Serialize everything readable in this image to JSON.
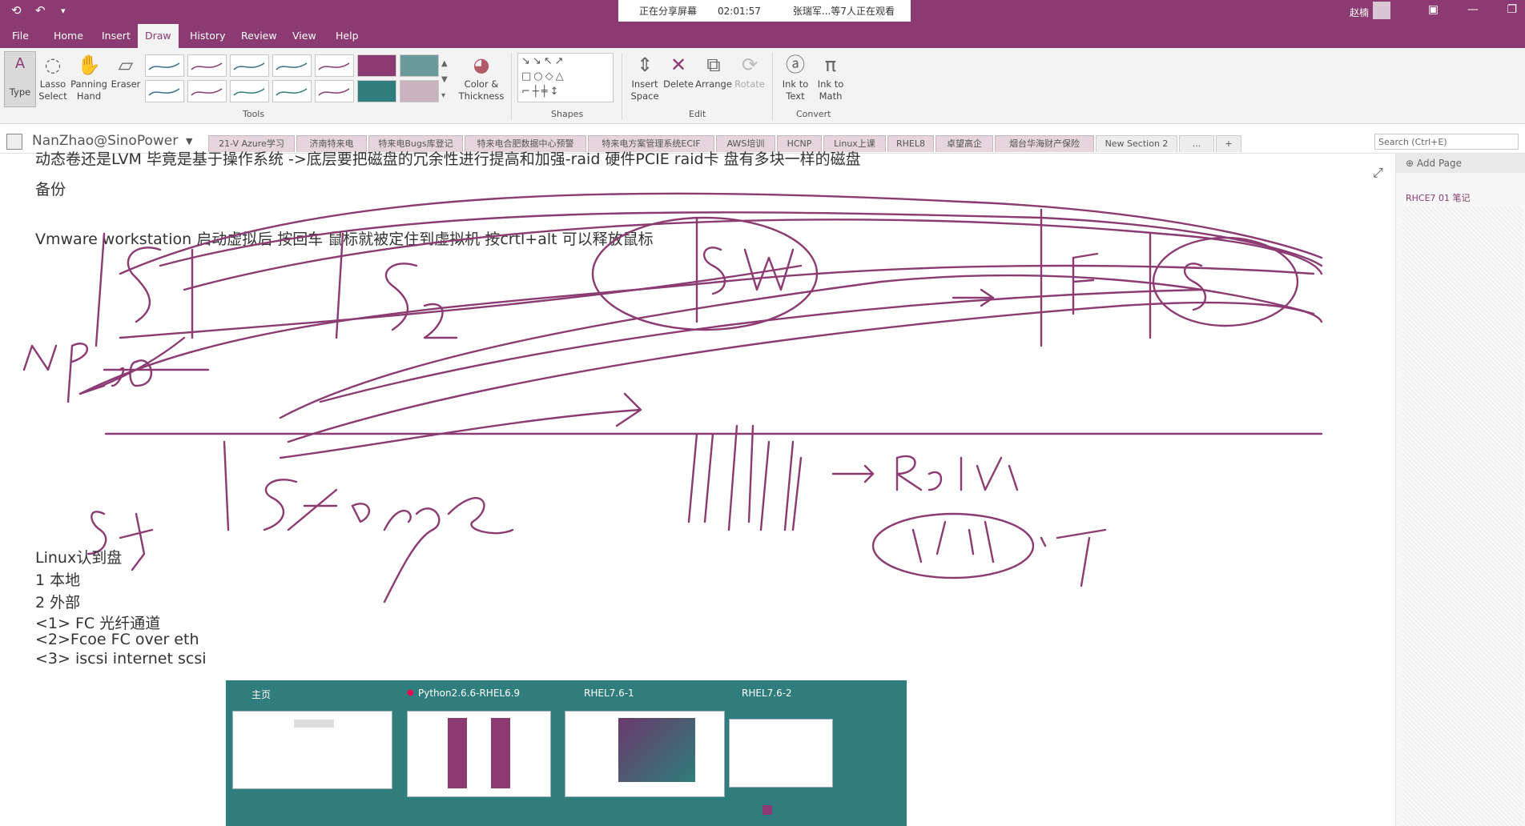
{
  "titlebar": {
    "share_status": "正在分享屏幕",
    "share_time": "02:01:57",
    "viewers": "张瑞军...等7人正在观看",
    "user": "赵楠"
  },
  "menu": [
    "File",
    "Home",
    "Insert",
    "Draw",
    "History",
    "Review",
    "View",
    "Help"
  ],
  "ribbon": {
    "type_label": "Type",
    "lasso_label": "Lasso Select",
    "panning_label": "Panning Hand",
    "eraser_label": "Eraser",
    "tools_group": "Tools",
    "color_label": "Color & Thickness",
    "shapes_group": "Shapes",
    "insert_space_label": "Insert Space",
    "delete_label": "Delete",
    "arrange_label": "Arrange",
    "rotate_label": "Rotate",
    "edit_group": "Edit",
    "ink_text_label": "Ink to Text",
    "ink_math_label": "Ink to Math",
    "convert_group": "Convert",
    "pen_colors": [
      "#3a6d8c",
      "#8b3a72",
      "#3a6d8c",
      "#3a6d8c",
      "#8b3a72",
      "#2f7d7c"
    ]
  },
  "notebook": {
    "name": "NanZhao@SinoPower",
    "tabs": [
      "21-V Azure学习",
      "济南特来电",
      "特来电Bugs库登记",
      "特来电合肥数据中心预警",
      "特来电方案管理系统ECIF",
      "AWS培训",
      "HCNP",
      "Linux上课",
      "RHEL8",
      "卓望高企",
      "烟台华海财产保险",
      "New Section 2",
      "..."
    ],
    "add_tab": "+",
    "search_placeholder": "Search (Ctrl+E)"
  },
  "page": {
    "line1": "动态卷还是LVM 毕竟是基于操作系统 ->底层要把磁盘的冗余性进行提高和加强-raid 硬件PCIE  raid卡 盘有多块一样的磁盘",
    "line2": "备份",
    "line3": "Vmware workstation 启动虚拟后  按回车  鼠标就被定住到虚拟机 按crtl+alt 可以释放鼠标",
    "list": [
      "Linux认到盘",
      "1 本地",
      "2 外部",
      "<1> FC 光纤通道",
      "<2>Fcoe   FC over eth",
      "<3>  iscsi internet scsi"
    ]
  },
  "sidebar": {
    "add_page": "Add Page",
    "page_title": "RHCE7 01 笔记"
  },
  "thumbnails": [
    {
      "title": "主页"
    },
    {
      "title": "Python2.6.6-RHEL6.9"
    },
    {
      "title": "RHEL7.6-1"
    },
    {
      "title": "RHEL7.6-2"
    }
  ]
}
